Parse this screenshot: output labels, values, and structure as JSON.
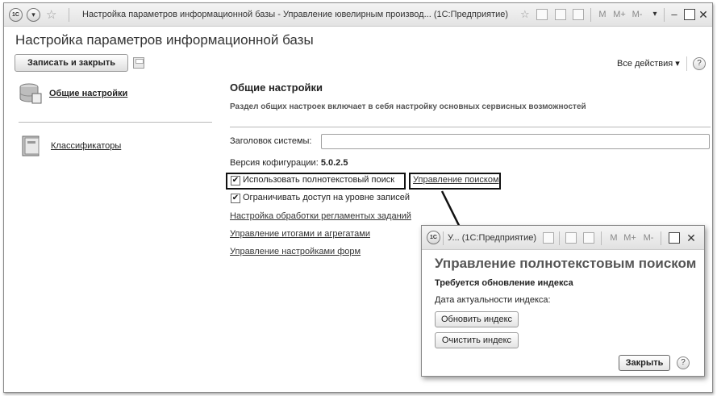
{
  "window": {
    "logo": "1С",
    "title": "Настройка параметров информационной базы - Управление ювелирным производ... (1С:Предприятие)",
    "buttons": {
      "m": "M",
      "m_plus": "M+",
      "m_minus": "M-"
    }
  },
  "form": {
    "title": "Настройка параметров информационной базы",
    "save_close_label": "Записать и закрыть",
    "all_actions_label": "Все действия ▾",
    "help_label": "?"
  },
  "nav": {
    "items": [
      {
        "label": "Общие настройки",
        "icon": "database-icon",
        "active": true
      },
      {
        "label": "Классификаторы",
        "icon": "book-icon",
        "active": false
      }
    ]
  },
  "content": {
    "section_title": "Общие настройки",
    "section_desc": "Раздел общих настроек включает в себя настройку основных сервисных возможностей",
    "system_title_label": "Заголовок системы:",
    "system_title_value": "",
    "version_label": "Версия кофигурации:",
    "version_value": "5.0.2.5",
    "fulltext_label": "Использовать полнотекстовый поиск",
    "fulltext_checked": true,
    "search_mgmt_link": "Управление поиском",
    "restrict_label": "Ограничивать доступ на уровне записей",
    "restrict_checked": true,
    "links": [
      "Настройка обработки регламентых заданий",
      "Управление итогами и агрегатами",
      "Управление настройками форм"
    ]
  },
  "dialog": {
    "window_title": "У... (1С:Предприятие)",
    "heading": "Управление полнотекстовым поиском",
    "warning": "Требуется обновление индекса",
    "date_label": "Дата актуальности индекса:",
    "update_button": "Обновить индекс",
    "clear_button": "Очистить индекс",
    "close_button": "Закрыть",
    "help_label": "?"
  },
  "colors": {
    "highlight_border": "#111111",
    "accent_arrow": "#111111"
  }
}
